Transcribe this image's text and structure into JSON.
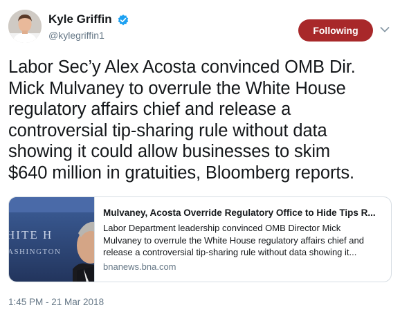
{
  "author": {
    "display_name": "Kyle Griffin",
    "handle": "@kylegriffin1",
    "verified": true,
    "avatar_icon": "person-avatar"
  },
  "follow_button": {
    "label": "Following",
    "color": "#a8282a"
  },
  "menu": {
    "icon": "chevron-down-icon"
  },
  "tweet": {
    "lines": [
      "Labor Sec’y Alex Acosta convinced OMB Dir.",
      "Mick Mulvaney to overrule the White House",
      "regulatory affairs chief and release a",
      "controversial tip-sharing rule without data",
      "showing it could allow businesses to skim",
      "$640 million in gratuities, Bloomberg reports."
    ]
  },
  "card": {
    "title": "Mulvaney, Acosta Override Regulatory Office to Hide Tips R...",
    "description_lines": [
      "Labor Department leadership convinced OMB Director Mick",
      "Mulvaney to overrule the White House regulatory affairs chief and",
      "release a controversial tip-sharing rule without data showing it..."
    ],
    "domain": "bnanews.bna.com",
    "image_text": [
      "HITE H",
      "ASHINGTON"
    ]
  },
  "timestamp": "1:45 PM - 21 Mar 2018",
  "colors": {
    "text": "#14171a",
    "secondary": "#657786",
    "verified": "#1da1f2",
    "border": "#d6dde3"
  }
}
